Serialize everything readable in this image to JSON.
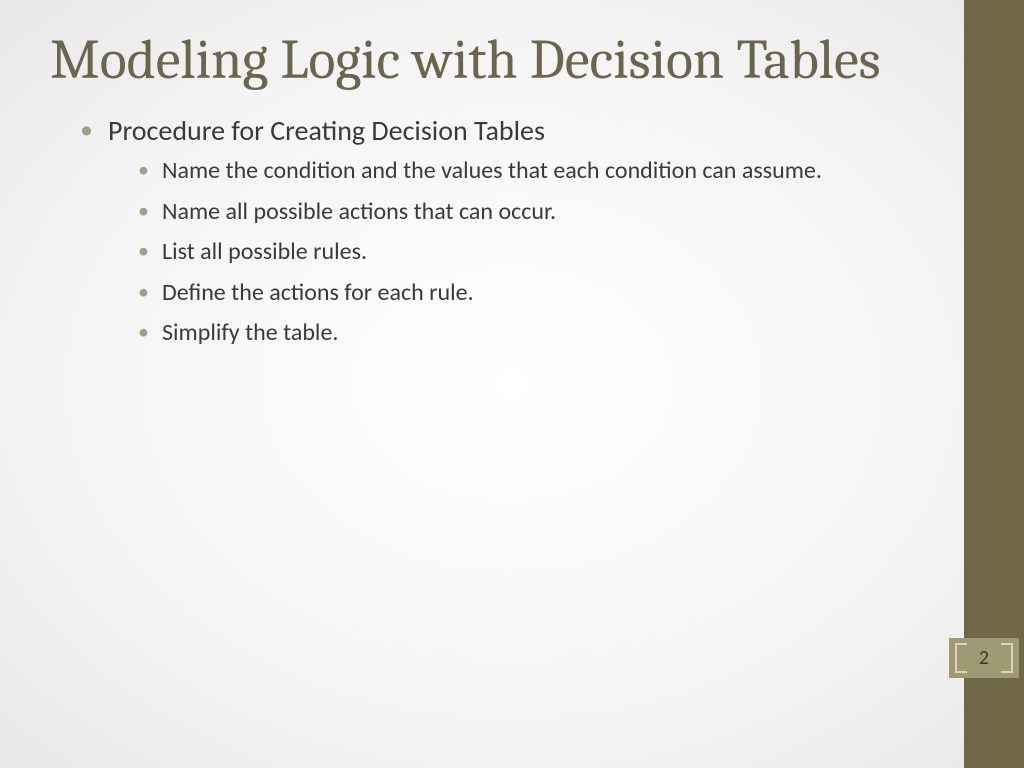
{
  "slide": {
    "title": "Modeling Logic with Decision Tables",
    "heading": "Procedure for Creating Decision Tables",
    "sub_items": [
      "Name the condition and the values that each condition can assume.",
      "Name all possible actions that can occur.",
      "List all possible rules.",
      "Define the actions for each rule.",
      "Simplify the table."
    ],
    "page_number": "2"
  }
}
